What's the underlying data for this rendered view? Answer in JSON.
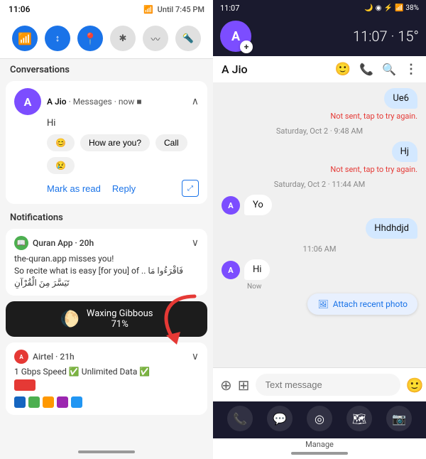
{
  "left": {
    "statusBar": {
      "time": "11:06",
      "signal": "📶",
      "battery": "Until 7:45 PM"
    },
    "quickTiles": [
      {
        "icon": "📶",
        "type": "blue",
        "label": "wifi"
      },
      {
        "icon": "↕",
        "type": "blue2",
        "label": "data"
      },
      {
        "icon": "📍",
        "type": "blue3",
        "label": "location"
      },
      {
        "icon": "✱",
        "type": "gray",
        "label": "bluetooth"
      },
      {
        "icon": "〰",
        "type": "gray2",
        "label": "nfc"
      },
      {
        "icon": "🔦",
        "type": "gray3",
        "label": "flashlight"
      }
    ],
    "conversations": {
      "label": "Conversations",
      "item": {
        "avatar": "A",
        "name": "A Jio",
        "source": "Messages",
        "time": "now",
        "message": "Hi",
        "actions": [
          {
            "label": "😊",
            "type": "emoji"
          },
          {
            "label": "How are you?",
            "type": "text"
          },
          {
            "label": "Call",
            "type": "text"
          },
          {
            "label": "😢",
            "type": "emoji"
          }
        ],
        "markAsRead": "Mark as read",
        "reply": "Reply"
      }
    },
    "notifications": {
      "label": "Notifications",
      "items": [
        {
          "app": "Quran App",
          "time": "20h",
          "text": "the-quran.app misses you!\nSo recite what is easy [for you] of .. فَاقْرَءُوا مَا تَيَسَّرَ مِنَ الْقُرْآنِ"
        }
      ]
    },
    "moon": {
      "phase": "Waxing Gibbous",
      "percent": "71%"
    },
    "airtel": {
      "app": "Airtel",
      "time": "21h",
      "text": "1 Gbps Speed ✅ Unlimited Data ✅"
    }
  },
  "right": {
    "statusBar": {
      "time": "11:07",
      "battery": "38%"
    },
    "floatingHeader": {
      "avatar": "A",
      "timeTemp": "11:07 · 15°"
    },
    "appBar": {
      "contactName": "A Jio",
      "icons": [
        "emoji-icon",
        "phone-icon",
        "search-icon",
        "more-icon"
      ]
    },
    "messages": [
      {
        "type": "right-msg",
        "text": "Ue6"
      },
      {
        "type": "not-sent",
        "text": "Not sent, tap to try again."
      },
      {
        "type": "date",
        "text": "Saturday, Oct 2 · 9:48 AM"
      },
      {
        "type": "right-msg",
        "text": "Hj"
      },
      {
        "type": "not-sent",
        "text": "Not sent, tap to try again."
      },
      {
        "type": "date",
        "text": "Saturday, Oct 2 · 11:44 AM"
      },
      {
        "type": "left-msg",
        "text": "Yo",
        "showAvatar": true
      },
      {
        "type": "right-msg",
        "text": "Hhdhdjd"
      },
      {
        "type": "date",
        "text": "11:06 AM"
      },
      {
        "type": "left-msg",
        "text": "Hi",
        "showAvatar": true
      },
      {
        "type": "now",
        "text": "Now"
      },
      {
        "type": "attach",
        "text": "Attach recent photo"
      }
    ],
    "input": {
      "placeholder": "Text message"
    },
    "navBar": {
      "items": [
        "phone-nav",
        "messages-nav",
        "chrome-nav",
        "maps-nav",
        "camera-nav"
      ]
    },
    "manage": {
      "label": "Manage"
    }
  }
}
